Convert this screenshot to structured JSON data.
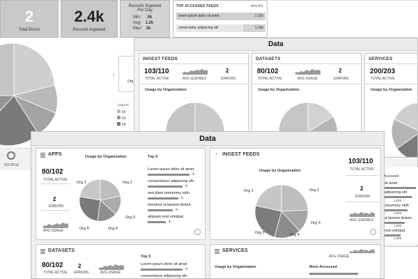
{
  "back": {
    "tile1": {
      "value": "2",
      "caption": "Total Errors"
    },
    "tile2": {
      "value": "2.4k",
      "caption": "Records Ingested"
    },
    "tile3": {
      "title_line1": "Records Ingested",
      "title_line2": "Per Day",
      "min_label": "Min:",
      "min_value": ".5k",
      "avg_label": "Avg:",
      "avg_value": "1.2k",
      "max_label": "Max:",
      "max_value": "2k"
    },
    "top_feeds": {
      "title": "TOP ACCESSED FEEDS",
      "link": "view list",
      "rows": [
        {
          "name": "lorem ipsum dolor sit amet",
          "value": "1.32k"
        },
        {
          "name": "consectetur adipiscing elit",
          "value": "1.32k"
        }
      ]
    },
    "legend_label": "Legend",
    "org_labels": [
      "Or",
      "Or",
      "Or"
    ],
    "org_left_label": "Org",
    "source_label": "SOURCE"
  },
  "middle": {
    "title": "Data",
    "ingest": {
      "title": "INGEST FEEDS",
      "active": "103/110",
      "active_label": "TOTAL ACTIVE",
      "queries_label": "AVG QUERIES",
      "errors": "2",
      "errors_label": "ERRORS",
      "usage_title": "Usage by Organization"
    },
    "datasets": {
      "title": "DATASETS",
      "active": "80/102",
      "active_label": "TOTAL ACTIVE",
      "usage_label": "AVG USAGE",
      "errors": "2",
      "errors_label": "ERRORS",
      "usage_title": "Usage by Organization"
    },
    "services": {
      "title": "SERVICES",
      "active": "200/203",
      "active_label": "TOTAL ACTIVE",
      "usage_title": "Usage by Organization"
    }
  },
  "front": {
    "title": "Data",
    "apps": {
      "title": "APPS",
      "active": "80/102",
      "active_label": "TOTAL ACTIVE",
      "errors": "2",
      "errors_label": "ERRORS",
      "usage_label": "AVG USAGE",
      "usage_title": "Usage by Organization",
      "orgs": [
        "Org 1",
        "Org 2",
        "Org 3",
        "Org 4",
        "Org 5"
      ],
      "top5_title": "Top 5",
      "top5": [
        "Lorem ipsum dolor sit amet",
        "consectetuer adipiscing elit",
        "sed diam nonummy nibh",
        "tincidunt ut laoreet dolore",
        "aliquam erat volutpat"
      ],
      "unit": "/k"
    },
    "ingest": {
      "title": "INGEST FEEDS",
      "usage_title": "Usage by Organization",
      "orgs": [
        "Org 1",
        "Org 2",
        "Org 3",
        "Org 4",
        "Org 5"
      ],
      "active": "103/110",
      "active_label": "TOTAL ACTIVE",
      "errors": "2",
      "errors_label": "ERRORS",
      "queries_label": "AVG QUERIES"
    },
    "datasets": {
      "title": "DATASETS",
      "active": "80/102",
      "active_label": "TOTAL ACTIVE",
      "errors": "2",
      "errors_label": "ERRORS",
      "usage_label": "AVG USAGE",
      "top5_title": "Top 5",
      "top5": [
        "Lorem ipsum dolor sit amet",
        "consectetuer adipiscing elit"
      ],
      "unit": "/k"
    },
    "services": {
      "title": "SERVICES",
      "usage_label": "AVG USAGE",
      "usage_title": "Usage by Organization",
      "most_accessed_title": "Most Accessed"
    }
  },
  "right_edge": {
    "accessed_label": "Accessed",
    "items": [
      "sit amet",
      "adipiscing elit",
      "nonummy nibh",
      "ut laoreet dolore",
      "erat volutpat"
    ],
    "values": [
      "1,000",
      "1,000",
      "1,000",
      "1,000"
    ]
  }
}
